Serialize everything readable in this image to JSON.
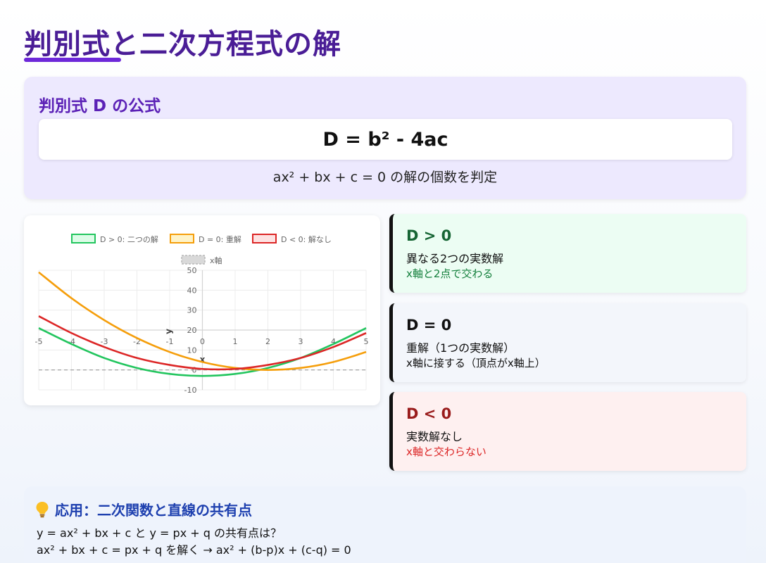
{
  "page": {
    "title": "判別式と二次方程式の解"
  },
  "formula": {
    "heading": "判別式 D の公式",
    "expression": "D = b² - 4ac",
    "subtitle": "ax² + bx + c = 0 の解の個数を判定"
  },
  "cases": [
    {
      "title": "D > 0",
      "description": "異なる2つの実数解",
      "note": "x軸と2点で交わる",
      "background": "#ecfdf3",
      "title_color": "#166534",
      "note_color": "#15803d"
    },
    {
      "title": "D = 0",
      "description": "重解（1つの実数解）",
      "note": "x軸に接する（頂点がx軸上）",
      "background": "#f3f6fb",
      "title_color": "#111111",
      "note_color": "#111111"
    },
    {
      "title": "D < 0",
      "description": "実数解なし",
      "note": "x軸と交わらない",
      "background": "#fef0f0",
      "title_color": "#991b1b",
      "note_color": "#dc2626"
    }
  ],
  "application": {
    "icon": "lightbulb-icon",
    "heading": "応用：二次関数と直線の共有点",
    "line1": "y = ax² + bx + c と y = px + q の共有点は？",
    "line2": "ax² + bx + c = px + q を解く → ax² + (b-p)x + (c-q) = 0"
  },
  "chart_data": {
    "type": "line",
    "title": "",
    "xlabel": "x",
    "ylabel": "y",
    "xlim": [
      -5,
      5
    ],
    "ylim": [
      -10,
      50
    ],
    "x_ticks": [
      -5,
      -4,
      -3,
      -2,
      -1,
      0,
      1,
      2,
      3,
      4,
      5
    ],
    "y_ticks": [
      -10,
      0,
      10,
      20,
      30,
      40,
      50
    ],
    "grid": true,
    "legend_position": "top",
    "x": [
      -5,
      -4,
      -3,
      -2,
      -1,
      0,
      1,
      2,
      3,
      4,
      5
    ],
    "series": [
      {
        "name": "D > 0: 二つの解",
        "color": "#22c55e",
        "fill": "#dcfce7",
        "values": [
          21,
          13,
          6,
          1,
          -2,
          -3,
          -2,
          1,
          6,
          13,
          21
        ]
      },
      {
        "name": "D = 0: 重解",
        "color": "#f59e0b",
        "fill": "#fef3c7",
        "values": [
          49,
          36,
          25,
          16,
          9,
          4,
          1,
          0,
          1,
          4,
          9
        ]
      },
      {
        "name": "D < 0: 解なし",
        "color": "#dc2626",
        "fill": "#fde2e2",
        "values": [
          27,
          18.5,
          11.5,
          6,
          2.5,
          0.5,
          0.5,
          2.5,
          6,
          11.5,
          18.5
        ]
      },
      {
        "name": "x軸",
        "color": "#999999",
        "fill": "#d9d9d9",
        "dashed": true,
        "values": [
          0,
          0,
          0,
          0,
          0,
          0,
          0,
          0,
          0,
          0,
          0
        ]
      }
    ]
  }
}
